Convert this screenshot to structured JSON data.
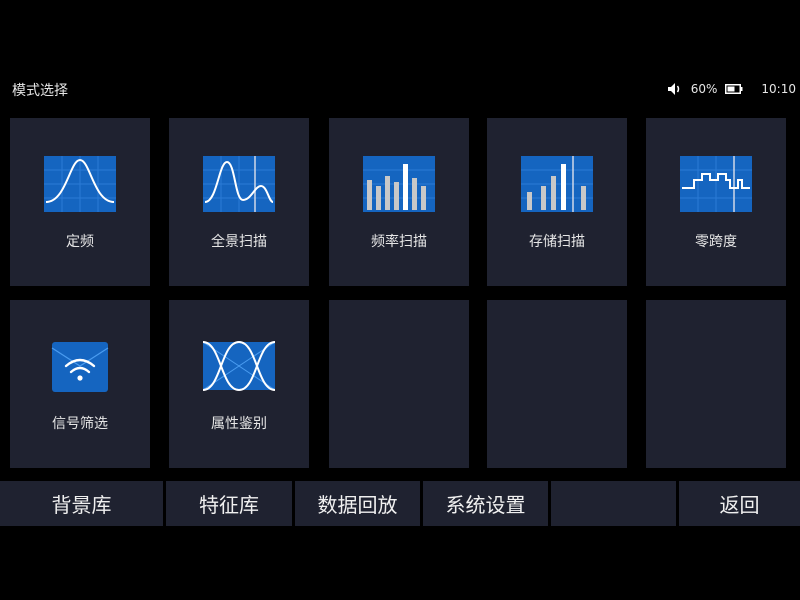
{
  "header": {
    "title": "模式选择",
    "volume_icon": "speaker-icon",
    "battery_percent": "60%",
    "battery_icon": "battery-icon",
    "time": "10:10"
  },
  "tiles": [
    {
      "label": "定频",
      "icon": "gaussian-peak-icon"
    },
    {
      "label": "全景扫描",
      "icon": "spectrum-peaks-icon"
    },
    {
      "label": "频率扫描",
      "icon": "bar-spectrum-icon"
    },
    {
      "label": "存储扫描",
      "icon": "bar-spectrum-highlight-icon"
    },
    {
      "label": "零跨度",
      "icon": "square-wave-icon"
    },
    {
      "label": "信号筛选",
      "icon": "wifi-box-icon"
    },
    {
      "label": "属性鉴别",
      "icon": "eye-diagram-icon"
    }
  ],
  "bottom": {
    "background_lib": "背景库",
    "feature_lib": "特征库",
    "data_playback": "数据回放",
    "system_settings": "系统设置",
    "back": "返回"
  },
  "colors": {
    "background": "#000000",
    "tile": "#1f2230",
    "accent": "#1565c0",
    "text": "#e6e6e6"
  }
}
